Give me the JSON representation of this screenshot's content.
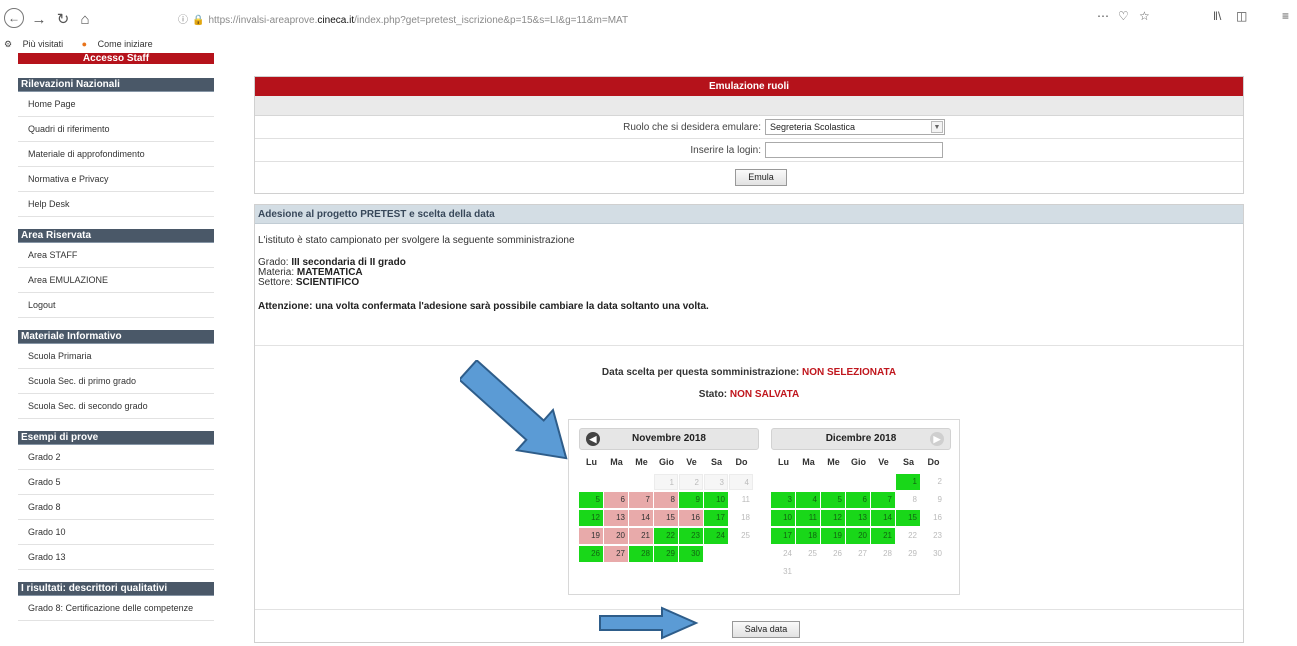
{
  "browser": {
    "url_prefix": "https://invalsi-areaprove.",
    "url_domain": "cineca.it",
    "url_suffix": "/index.php?get=pretest_iscrizione&p=15&s=LI&g=11&m=MAT",
    "bookmarks": [
      "Più visitati",
      "Come iniziare"
    ]
  },
  "sidebar": {
    "staff_header": "Accesso Staff",
    "sections": [
      {
        "title": "Rilevazioni Nazionali",
        "items": [
          "Home Page",
          "Quadri di riferimento",
          "Materiale di approfondimento",
          "Normativa e Privacy",
          "Help Desk"
        ]
      },
      {
        "title": "Area Riservata",
        "items": [
          "Area STAFF",
          "Area EMULAZIONE",
          "Logout"
        ]
      },
      {
        "title": "Materiale Informativo",
        "items": [
          "Scuola Primaria",
          "Scuola Sec. di primo grado",
          "Scuola Sec. di secondo grado"
        ]
      },
      {
        "title": "Esempi di prove",
        "items": [
          "Grado 2",
          "Grado 5",
          "Grado 8",
          "Grado 10",
          "Grado 13"
        ]
      },
      {
        "title": "I risultati: descrittori qualitativi",
        "items": [
          "Grado 8: Certificazione delle competenze"
        ]
      }
    ]
  },
  "emulation": {
    "header": "Emulazione ruoli",
    "role_label": "Ruolo che si desidera emulare:",
    "role_value": "Segreteria Scolastica",
    "login_label": "Inserire la login:",
    "login_value": "",
    "button": "Emula"
  },
  "adesione": {
    "header": "Adesione al progetto PRETEST e scelta della data",
    "intro": "L'istituto è stato campionato per svolgere la seguente somministrazione",
    "grado_label": "Grado:",
    "grado_value": "III secondaria di II grado",
    "materia_label": "Materia:",
    "materia_value": "MATEMATICA",
    "settore_label": "Settore:",
    "settore_value": "SCIENTIFICO",
    "warning": "Attenzione: una volta confermata l'adesione sarà possibile cambiare la data soltanto una volta.",
    "date_label": "Data scelta per questa somministrazione:",
    "date_value": "NON SELEZIONATA",
    "stato_label": "Stato:",
    "stato_value": "NON SALVATA",
    "save_button": "Salva data"
  },
  "calendars": {
    "weekdays": [
      "Lu",
      "Ma",
      "Me",
      "Gio",
      "Ve",
      "Sa",
      "Do"
    ],
    "months": [
      {
        "title": "Novembre 2018",
        "offset": 3,
        "days": [
          {
            "d": "1",
            "s": "n"
          },
          {
            "d": "2",
            "s": "n"
          },
          {
            "d": "3",
            "s": "n"
          },
          {
            "d": "4",
            "s": "n"
          },
          {
            "d": "5",
            "s": "g"
          },
          {
            "d": "6",
            "s": "r"
          },
          {
            "d": "7",
            "s": "r"
          },
          {
            "d": "8",
            "s": "r"
          },
          {
            "d": "9",
            "s": "g"
          },
          {
            "d": "10",
            "s": "g"
          },
          {
            "d": "11",
            "s": "o"
          },
          {
            "d": "12",
            "s": "g"
          },
          {
            "d": "13",
            "s": "r"
          },
          {
            "d": "14",
            "s": "r"
          },
          {
            "d": "15",
            "s": "r"
          },
          {
            "d": "16",
            "s": "r"
          },
          {
            "d": "17",
            "s": "g"
          },
          {
            "d": "18",
            "s": "o"
          },
          {
            "d": "19",
            "s": "r"
          },
          {
            "d": "20",
            "s": "r"
          },
          {
            "d": "21",
            "s": "r"
          },
          {
            "d": "22",
            "s": "g"
          },
          {
            "d": "23",
            "s": "g"
          },
          {
            "d": "24",
            "s": "g"
          },
          {
            "d": "25",
            "s": "o"
          },
          {
            "d": "26",
            "s": "g"
          },
          {
            "d": "27",
            "s": "r"
          },
          {
            "d": "28",
            "s": "g"
          },
          {
            "d": "29",
            "s": "g"
          },
          {
            "d": "30",
            "s": "g"
          }
        ]
      },
      {
        "title": "Dicembre 2018",
        "offset": 5,
        "days": [
          {
            "d": "1",
            "s": "g"
          },
          {
            "d": "2",
            "s": "o"
          },
          {
            "d": "3",
            "s": "g"
          },
          {
            "d": "4",
            "s": "g"
          },
          {
            "d": "5",
            "s": "g"
          },
          {
            "d": "6",
            "s": "g"
          },
          {
            "d": "7",
            "s": "g"
          },
          {
            "d": "8",
            "s": "o"
          },
          {
            "d": "9",
            "s": "o"
          },
          {
            "d": "10",
            "s": "g"
          },
          {
            "d": "11",
            "s": "g"
          },
          {
            "d": "12",
            "s": "g"
          },
          {
            "d": "13",
            "s": "g"
          },
          {
            "d": "14",
            "s": "g"
          },
          {
            "d": "15",
            "s": "g"
          },
          {
            "d": "16",
            "s": "o"
          },
          {
            "d": "17",
            "s": "g"
          },
          {
            "d": "18",
            "s": "g"
          },
          {
            "d": "19",
            "s": "g"
          },
          {
            "d": "20",
            "s": "g"
          },
          {
            "d": "21",
            "s": "g"
          },
          {
            "d": "22",
            "s": "o"
          },
          {
            "d": "23",
            "s": "o"
          },
          {
            "d": "24",
            "s": "o"
          },
          {
            "d": "25",
            "s": "o"
          },
          {
            "d": "26",
            "s": "o"
          },
          {
            "d": "27",
            "s": "o"
          },
          {
            "d": "28",
            "s": "o"
          },
          {
            "d": "29",
            "s": "o"
          },
          {
            "d": "30",
            "s": "o"
          },
          {
            "d": "31",
            "s": "o"
          }
        ]
      }
    ]
  },
  "colors": {
    "red": "#b5121b",
    "sidebar_header": "#4a5868",
    "available_day": "#19d719",
    "unavailable_day": "#e8aaaa",
    "arrow_fill": "#5b9bd5",
    "arrow_stroke": "#2e5d8a"
  }
}
